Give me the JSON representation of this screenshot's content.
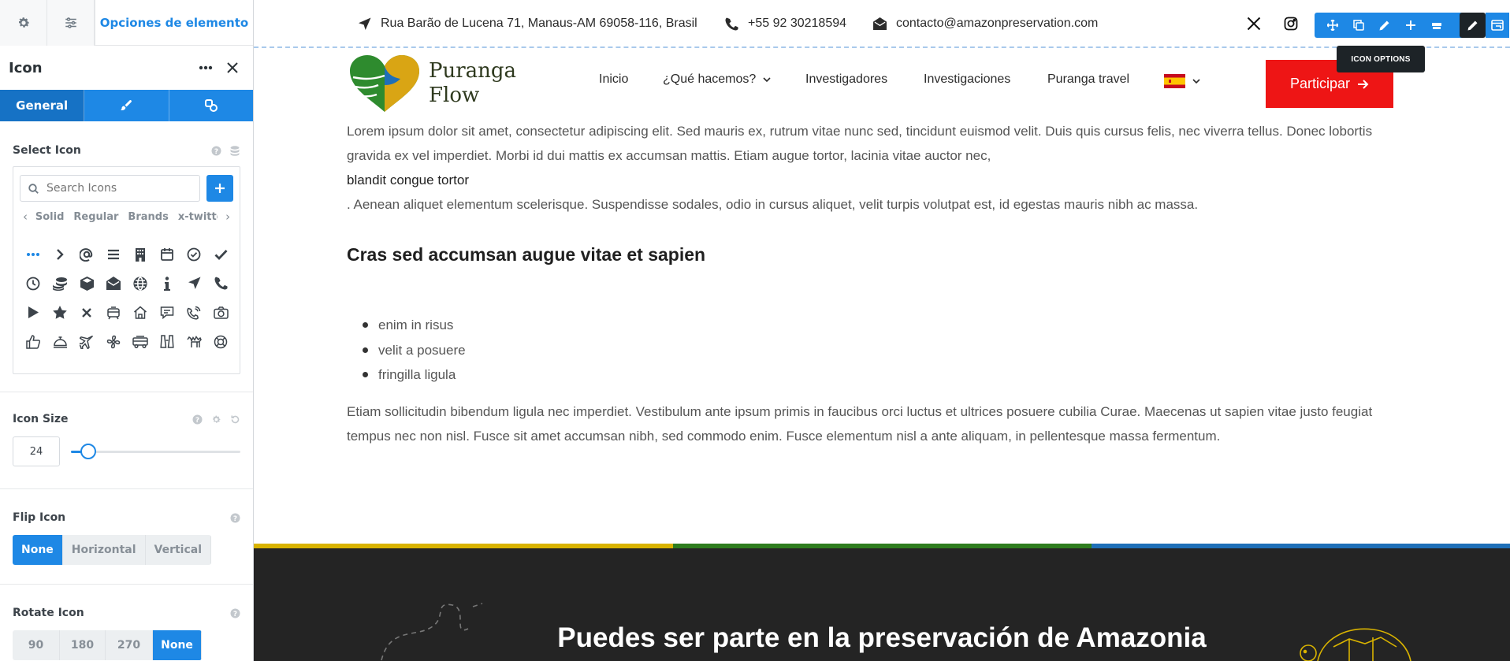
{
  "panel": {
    "header_tab": "Opciones de elemento",
    "element_title": "Icon",
    "subtabs": [
      "General"
    ],
    "select_icon": {
      "label": "Select Icon",
      "search_placeholder": "Search Icons",
      "categories": [
        "Solid",
        "Regular",
        "Brands",
        "x-twitter"
      ],
      "icons": [
        "ellipsis-icon",
        "chevron-right-icon",
        "at-icon",
        "bars-icon",
        "building-icon",
        "calendar-icon",
        "circle-check-icon",
        "check-icon",
        "clock-icon",
        "coins-icon",
        "cube-icon",
        "envelope-open-icon",
        "globe-icon",
        "info-icon",
        "location-arrow-icon",
        "phone-icon",
        "play-icon",
        "star-icon",
        "xmark-icon",
        "tram-icon",
        "house-icon",
        "comment-icon",
        "phone-volume-icon",
        "camera-icon",
        "thumbs-up-icon",
        "bell-concierge-icon",
        "plane-icon",
        "fan-icon",
        "truck-icon",
        "binoculars-icon",
        "camel-icon",
        "life-ring-icon"
      ]
    },
    "icon_size": {
      "label": "Icon Size",
      "value": "24",
      "fraction": 0.1
    },
    "flip_icon": {
      "label": "Flip Icon",
      "options": [
        "None",
        "Horizontal",
        "Vertical"
      ],
      "selected": "None"
    },
    "rotate_icon": {
      "label": "Rotate Icon",
      "options": [
        "90",
        "180",
        "270",
        "None"
      ],
      "selected": "None"
    }
  },
  "topbar": {
    "address": "Rua Barão de Lucena 71, Manaus-AM 69058-116, Brasil",
    "phone": "+55 92 30218594",
    "email": "contacto@amazonpreservation.com",
    "tooltip": "ICON OPTIONS",
    "social": [
      "x-twitter-icon",
      "instagram-icon"
    ]
  },
  "site": {
    "logo_line1": "Puranga",
    "logo_line2": "Flow",
    "nav": [
      "Inicio",
      "¿Qué hacemos?",
      "Investigadores",
      "Investigaciones",
      "Puranga travel"
    ],
    "cta": "Participar"
  },
  "content": {
    "para1": "Lorem ipsum dolor sit amet, consectetur adipiscing elit. Sed mauris ex, rutrum vitae nunc sed, tincidunt euismod velit. Duis quis cursus felis, nec viverra tellus. Donec lobortis gravida ex vel imperdiet. Morbi id dui mattis ex accumsan mattis. Etiam augue tortor, lacinia vitae auctor nec,",
    "highlight": "blandit congue tortor",
    "para1b": ". Aenean aliquet elementum scelerisque. Suspendisse sodales, odio in cursus aliquet, velit turpis volutpat est, id egestas mauris nibh ac massa.",
    "heading": "Cras sed accumsan augue vitae et sapien",
    "list": [
      "enim in risus",
      "velit a posuere",
      "fringilla ligula"
    ],
    "para2": "Etiam sollicitudin bibendum ligula nec imperdiet. Vestibulum ante ipsum primis in faucibus orci luctus et ultrices posuere cubilia Curae. Maecenas ut sapien vitae justo feugiat tempus nec non nisl. Fusce sit amet accumsan nibh, sed commodo enim. Fusce elementum nisl a ante aliquam, in pellentesque massa fermentum."
  },
  "footer": {
    "title": "Puedes ser parte en la preservación de Amazonia",
    "stripe_colors": [
      "#d9b300",
      "#2e7d1e",
      "#1e6fb8"
    ]
  },
  "colors": {
    "accent": "#1e88e5",
    "cta": "#ee1515",
    "footer_bg": "#242424"
  }
}
